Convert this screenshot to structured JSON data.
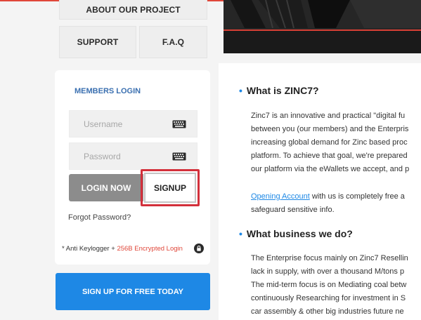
{
  "colors": {
    "accent": "#e0473a",
    "brand_blue": "#1e88e5",
    "members_title": "#3a6fb0",
    "signup_highlight": "#d3303b"
  },
  "nav": {
    "about": "ABOUT OUR PROJECT",
    "support": "SUPPORT",
    "faq": "F.A.Q"
  },
  "login": {
    "title": "MEMBERS LOGIN",
    "username_placeholder": "Username",
    "password_placeholder": "Password",
    "login_label": "LOGIN NOW",
    "signup_label": "SIGNUP",
    "forgot": "Forgot Password?",
    "keylogger_prefix": "* Anti Keylogger + ",
    "keylogger_enc": "256B Encrypted Login",
    "keyboard_icon": "keyboard-icon",
    "lock_icon": "lock-icon"
  },
  "cta": {
    "signup_free": "SIGN UP FOR FREE TODAY"
  },
  "content": {
    "section1_title": "What is ZINC7?",
    "section1_lines": [
      "Zinc7 is an innovative and practical \"digital fu",
      "between you (our members) and the Enterpris",
      "increasing global demand for Zinc based proc",
      "platform. To achieve that goal, we're prepared",
      "our platform via the eWallets we accept, and p"
    ],
    "opening_link": "Opening Account",
    "opening_rest": " with us is completely free a",
    "opening_line2": "safeguard sensitive info.",
    "section2_title": "What business we do?",
    "section2_lines": [
      "The Enterprise focus mainly on Zinc7  Resellin",
      "lack in supply, with over a thousand M/tons p",
      "The mid-term focus is on  Mediating coal betw",
      "continuously  Researching for investment in S",
      "car assembly & other big industries future ne"
    ]
  }
}
